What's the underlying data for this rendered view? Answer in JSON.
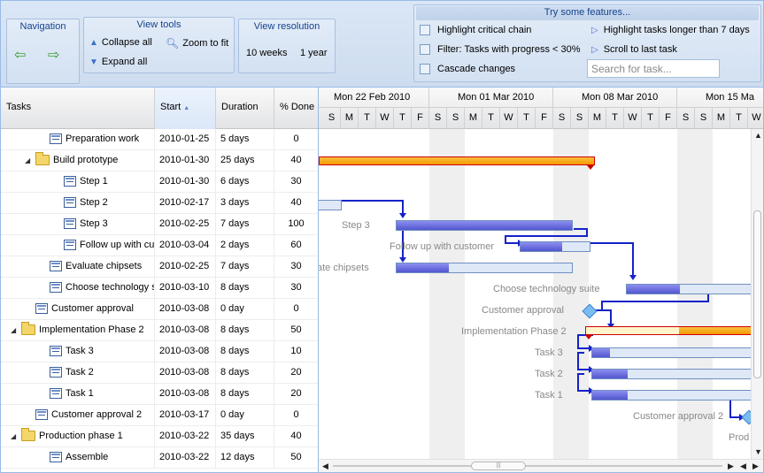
{
  "toolbar": {
    "navigation": {
      "title": "Navigation",
      "back_glyph": "⇦",
      "forward_glyph": "⇨"
    },
    "view_tools": {
      "title": "View tools",
      "collapse_all": "Collapse all",
      "expand_all": "Expand all",
      "zoom_to_fit": "Zoom to fit"
    },
    "view_resolution": {
      "title": "View resolution",
      "ten_weeks": "10 weeks",
      "one_year": "1 year"
    },
    "features": {
      "title": "Try some features...",
      "highlight_critical": "Highlight critical chain",
      "filter_progress": "Filter: Tasks with progress < 30%",
      "cascade_changes": "Cascade changes",
      "highlight_long": "Highlight tasks longer than 7 days",
      "scroll_last": "Scroll to last task",
      "search_placeholder": "Search for task..."
    }
  },
  "grid": {
    "headers": {
      "task": "Tasks",
      "start": "Start",
      "duration": "Duration",
      "done": "% Done"
    },
    "rows": [
      {
        "name": "Preparation work",
        "start": "2010-01-25",
        "duration": "5 days",
        "done": "0",
        "level": 2,
        "kind": "leaf"
      },
      {
        "name": "Build prototype",
        "start": "2010-01-30",
        "duration": "25 days",
        "done": "40",
        "level": 1,
        "kind": "folder"
      },
      {
        "name": "Step 1",
        "start": "2010-01-30",
        "duration": "6 days",
        "done": "30",
        "level": 3,
        "kind": "leaf"
      },
      {
        "name": "Step 2",
        "start": "2010-02-17",
        "duration": "3 days",
        "done": "40",
        "level": 3,
        "kind": "leaf"
      },
      {
        "name": "Step 3",
        "start": "2010-02-25",
        "duration": "7 days",
        "done": "100",
        "level": 3,
        "kind": "leaf"
      },
      {
        "name": "Follow up with custo",
        "start": "2010-03-04",
        "duration": "2 days",
        "done": "60",
        "level": 3,
        "kind": "leaf"
      },
      {
        "name": "Evaluate chipsets",
        "start": "2010-02-25",
        "duration": "7 days",
        "done": "30",
        "level": 2,
        "kind": "leaf"
      },
      {
        "name": "Choose technology suit",
        "start": "2010-03-10",
        "duration": "8 days",
        "done": "30",
        "level": 2,
        "kind": "leaf"
      },
      {
        "name": "Customer approval",
        "start": "2010-03-08",
        "duration": "0 day",
        "done": "0",
        "level": 1,
        "kind": "leaf"
      },
      {
        "name": "Implementation Phase 2",
        "start": "2010-03-08",
        "duration": "8 days",
        "done": "50",
        "level": 0,
        "kind": "folder"
      },
      {
        "name": "Task 3",
        "start": "2010-03-08",
        "duration": "8 days",
        "done": "10",
        "level": 2,
        "kind": "leaf"
      },
      {
        "name": "Task 2",
        "start": "2010-03-08",
        "duration": "8 days",
        "done": "20",
        "level": 2,
        "kind": "leaf"
      },
      {
        "name": "Task 1",
        "start": "2010-03-08",
        "duration": "8 days",
        "done": "20",
        "level": 2,
        "kind": "leaf"
      },
      {
        "name": "Customer approval 2",
        "start": "2010-03-17",
        "duration": "0 day",
        "done": "0",
        "level": 1,
        "kind": "leaf"
      },
      {
        "name": "Production phase 1",
        "start": "2010-03-22",
        "duration": "35 days",
        "done": "40",
        "level": 0,
        "kind": "folder"
      },
      {
        "name": "Assemble",
        "start": "2010-03-22",
        "duration": "12 days",
        "done": "50",
        "level": 2,
        "kind": "leaf"
      }
    ]
  },
  "schedule": {
    "weeks": [
      "Mon 22 Feb 2010",
      "Mon 01 Mar 2010",
      "Mon 08 Mar 2010",
      "Mon 15 Ma"
    ],
    "day_letters": [
      "S",
      "M",
      "T",
      "W",
      "T",
      "F",
      "S",
      "S",
      "M",
      "T",
      "W",
      "T",
      "F",
      "S",
      "S",
      "M",
      "T",
      "W",
      "T",
      "F",
      "S",
      "S",
      "M",
      "T",
      "W"
    ],
    "labels": {
      "step3": "Step 3",
      "follow_up": "Follow up with customer",
      "evaluate": "ate chipsets",
      "choose": "Choose technology suite",
      "cust_approval": "Customer approval",
      "impl_phase": "Implementation Phase 2",
      "task3": "Task 3",
      "task2": "Task 2",
      "task1": "Task 1",
      "cust_approval2": "Customer approval 2",
      "prod": "Prod"
    }
  }
}
